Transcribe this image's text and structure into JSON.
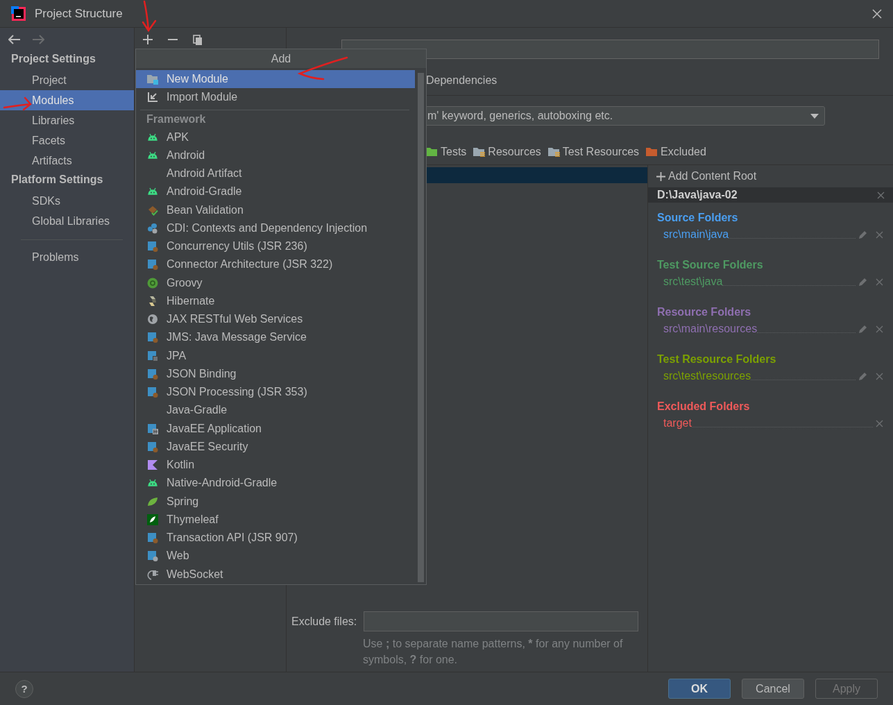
{
  "window": {
    "title": "Project Structure"
  },
  "sidebar": {
    "sections": [
      {
        "title": "Project Settings",
        "items": [
          {
            "label": "Project",
            "selected": false
          },
          {
            "label": "Modules",
            "selected": true
          },
          {
            "label": "Libraries",
            "selected": false
          },
          {
            "label": "Facets",
            "selected": false
          },
          {
            "label": "Artifacts",
            "selected": false
          }
        ]
      },
      {
        "title": "Platform Settings",
        "items": [
          {
            "label": "SDKs",
            "selected": false
          },
          {
            "label": "Global Libraries",
            "selected": false
          }
        ]
      }
    ],
    "problems": {
      "label": "Problems",
      "selected": false
    }
  },
  "add_popup": {
    "title": "Add",
    "items": [
      {
        "label": "New Module",
        "selected": true
      },
      {
        "label": "Import Module",
        "selected": false
      }
    ],
    "framework": {
      "title": "Framework",
      "items": [
        {
          "label": "APK",
          "selected": false
        },
        {
          "label": "Android",
          "selected": false
        },
        {
          "label": "Android Artifact",
          "selected": false
        },
        {
          "label": "Android-Gradle",
          "selected": false
        },
        {
          "label": "Bean Validation",
          "selected": false
        },
        {
          "label": "CDI: Contexts and Dependency Injection",
          "selected": false
        },
        {
          "label": "Concurrency Utils (JSR 236)",
          "selected": false
        },
        {
          "label": "Connector Architecture (JSR 322)",
          "selected": false
        },
        {
          "label": "Groovy",
          "selected": false
        },
        {
          "label": "Hibernate",
          "selected": false
        },
        {
          "label": "JAX RESTful Web Services",
          "selected": false
        },
        {
          "label": "JMS: Java Message Service",
          "selected": false
        },
        {
          "label": "JPA",
          "selected": false
        },
        {
          "label": "JSON Binding",
          "selected": false
        },
        {
          "label": "JSON Processing (JSR 353)",
          "selected": false
        },
        {
          "label": "Java-Gradle",
          "selected": false
        },
        {
          "label": "JavaEE Application",
          "selected": false
        },
        {
          "label": "JavaEE Security",
          "selected": false
        },
        {
          "label": "Kotlin",
          "selected": false
        },
        {
          "label": "Native-Android-Gradle",
          "selected": false
        },
        {
          "label": "Spring",
          "selected": false
        },
        {
          "label": "Thymeleaf",
          "selected": false
        },
        {
          "label": "Transaction API (JSR 907)",
          "selected": false
        },
        {
          "label": "Web",
          "selected": false
        },
        {
          "label": "WebSocket",
          "selected": false
        }
      ]
    }
  },
  "tabs": [
    {
      "label": "Dependencies",
      "selected": false
    }
  ],
  "language_level": {
    "value": "m' keyword, generics, autoboxing etc."
  },
  "mark_as": [
    {
      "label": "Tests"
    },
    {
      "label": "Resources"
    },
    {
      "label": "Test Resources"
    },
    {
      "label": "Excluded"
    }
  ],
  "tree_rows": [
    {
      "selected": true
    }
  ],
  "exclude_files": {
    "label": "Exclude files:",
    "hint": "Use **;** to separate name patterns, ***** for any number of symbols, **?** for one."
  },
  "content_root": {
    "add_label": "Add Content Root",
    "path": "D:\\Java\\java-02",
    "folder_groups": [
      {
        "title": "Source Folders",
        "color": "#4a9ff2",
        "paths": [
          "src\\main\\java"
        ]
      },
      {
        "title": "Test Source Folders",
        "color": "#4e9a62",
        "paths": [
          "src\\test\\java"
        ]
      },
      {
        "title": "Resource Folders",
        "color": "#8f6fb1",
        "paths": [
          "src\\main\\resources"
        ]
      },
      {
        "title": "Test Resource Folders",
        "color": "#7ca100",
        "paths": [
          "src\\test\\resources"
        ]
      },
      {
        "title": "Excluded Folders",
        "color": "#f05a5a",
        "paths": [
          "target"
        ]
      }
    ]
  },
  "help": {
    "label": "?"
  },
  "buttons": [
    {
      "label": "OK",
      "kind": "primary"
    },
    {
      "label": "Cancel",
      "kind": "normal"
    },
    {
      "label": "Apply",
      "kind": "disabled"
    }
  ]
}
